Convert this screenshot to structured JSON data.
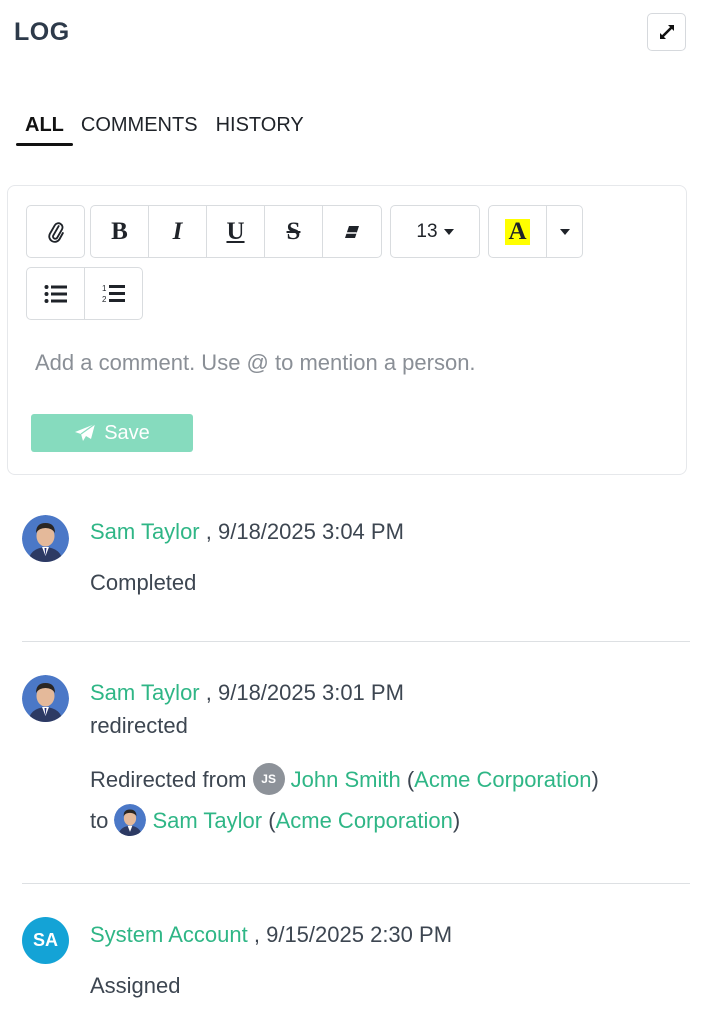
{
  "header": {
    "title": "LOG",
    "expand_icon": "expand-arrows-icon"
  },
  "tabs": [
    {
      "label": "ALL",
      "active": true
    },
    {
      "label": "COMMENTS",
      "active": false
    },
    {
      "label": "HISTORY",
      "active": false
    }
  ],
  "editor": {
    "toolbar": {
      "attach_icon": "paperclip-icon",
      "bold": "B",
      "italic": "I",
      "underline": "U",
      "strike": "S",
      "eraser_icon": "eraser-icon",
      "font_size": "13",
      "highlight": "A",
      "highlight_color": "#ffff00",
      "bullet_icon": "bulleted-list-icon",
      "numbered_icon": "numbered-list-icon"
    },
    "placeholder": "Add a comment. Use @ to mention a person.",
    "save_label": "Save",
    "save_color": "#86dbbe"
  },
  "entries": [
    {
      "author": "Sam Taylor",
      "timestamp": ", 9/18/2025 3:04 PM",
      "text": "Completed"
    },
    {
      "author": "Sam Taylor",
      "timestamp": ", 9/18/2025 3:01 PM",
      "action": "redirected",
      "redirect": {
        "from_prefix": "Redirected from",
        "from_initials": "JS",
        "from_name": "John Smith",
        "from_org": "Acme Corporation",
        "to_prefix": "to",
        "to_name": "Sam Taylor",
        "to_org": "Acme Corporation"
      }
    },
    {
      "author": "System Account",
      "initials": "SA",
      "timestamp": ", 9/15/2025 2:30 PM",
      "text": "Assigned"
    }
  ],
  "colors": {
    "link": "#2fb686",
    "system_avatar": "#14a3d6"
  }
}
